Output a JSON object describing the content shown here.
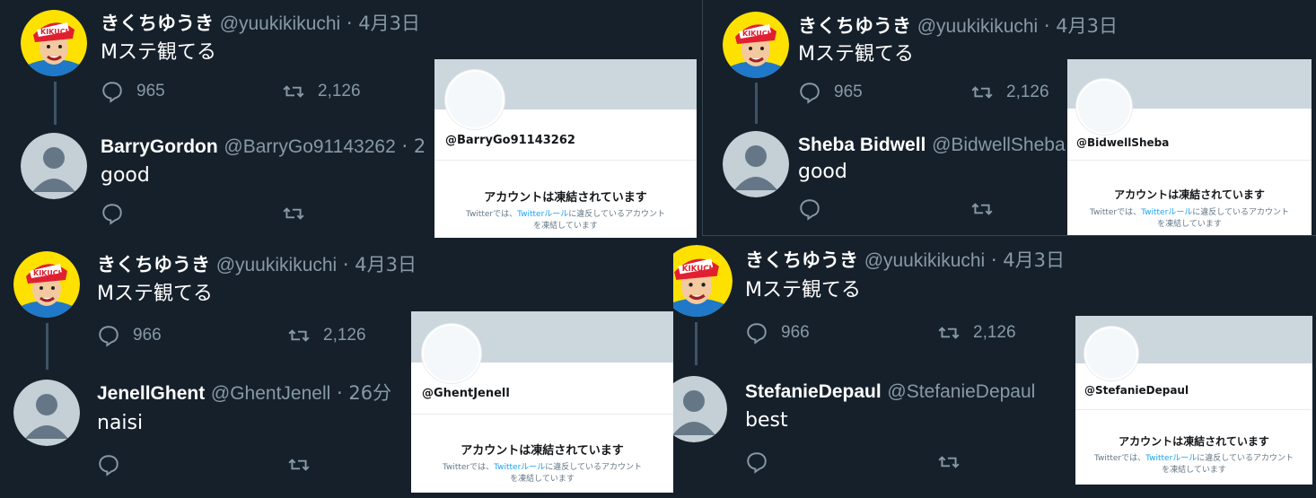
{
  "original_tweet": {
    "author_name": "きくちゆうき",
    "author_handle": "@yuukikikuchi",
    "separator": "·",
    "date": "4月3日",
    "text": "Mステ観てる"
  },
  "reply_counts": [
    "965",
    "965",
    "966",
    "966"
  ],
  "retweet_count": "2,126",
  "panels": [
    {
      "reply_name": "BarryGordon",
      "reply_handle": "@BarryGo91143262",
      "reply_time": "2",
      "reply_text": "good",
      "card_handle": "@BarryGo91143262"
    },
    {
      "reply_name": "Sheba Bidwell",
      "reply_handle": "@BidwellSheba",
      "reply_time": "",
      "reply_text": "good",
      "card_handle": "@BidwellSheba"
    },
    {
      "reply_name": "JenellGhent",
      "reply_handle": "@GhentJenell",
      "reply_time": "26分",
      "reply_text": "naisi",
      "card_handle": "@GhentJenell"
    },
    {
      "reply_name": "StefanieDepaul",
      "reply_handle": "@StefanieDepaul",
      "reply_time": "",
      "reply_text": "best",
      "card_handle": "@StefanieDepaul"
    }
  ],
  "suspended_card": {
    "title": "アカウントは凍結されています",
    "desc_pre": "Twitterでは、",
    "desc_link": "Twitterルール",
    "desc_post": "に違反しているアカウント",
    "desc_line2": "を凍結しています"
  },
  "colors": {
    "background": "#15202b",
    "secondary_text": "#8899a6",
    "link": "#1da1f2",
    "card_banner": "#ccd6dd"
  },
  "icons": [
    "reply-icon",
    "retweet-icon",
    "default-avatar-icon",
    "kikuchi-avatar-icon"
  ]
}
